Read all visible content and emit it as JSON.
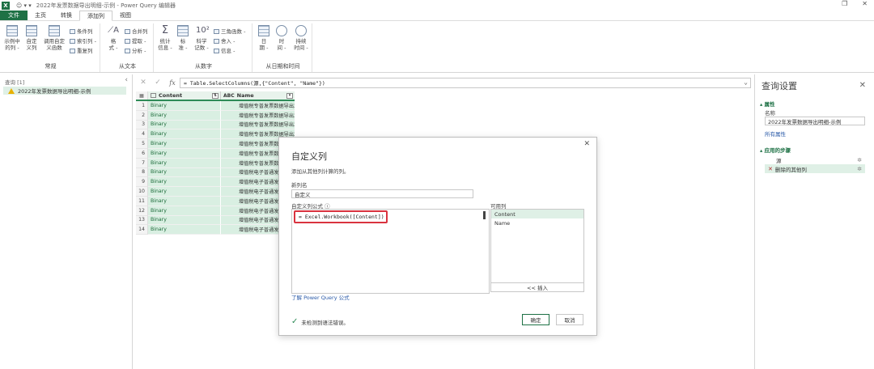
{
  "window": {
    "app_badge": "X",
    "title": "2022年发票数据导出明细-示例 - Power Query 编辑器",
    "qat": "☺ ▾ ▾"
  },
  "tabs": [
    {
      "label": "文件"
    },
    {
      "label": "主页"
    },
    {
      "label": "转换"
    },
    {
      "label": "添加列"
    },
    {
      "label": "视图"
    }
  ],
  "ribbon": {
    "general": {
      "label": "常规",
      "example_col": "示例中\n的列 -",
      "custom_col": "自定\n义列",
      "invoke_func": "调用自定\n义函数",
      "cond_col": "条件列",
      "index_col": "索引列 -",
      "dup_col": "重复列"
    },
    "from_text": {
      "label": "从文本",
      "format": "格\n式 -",
      "merge": "合并列",
      "extract": "提取 -",
      "parse": "分析 -"
    },
    "from_number": {
      "label": "从数字",
      "stats": "统计\n信息 -",
      "standard": "标\n准 -",
      "scientific": "科学\n记数 -",
      "trig": "三角函数 -",
      "round": "舍入 -",
      "info": "信息 -"
    },
    "from_datetime": {
      "label": "从日期和时间",
      "date": "日\n期 -",
      "time": "时\n间 -",
      "duration": "持续\n时间 -"
    }
  },
  "queries_pane": {
    "header": "查询 [1]",
    "item": "2022年发票数据导出明细-示例"
  },
  "formula_bar": {
    "cancel": "✕",
    "commit": "✓",
    "fx": "fx",
    "formula": "= Table.SelectColumns(源,{\"Content\", \"Name\"})"
  },
  "grid": {
    "col_content": "Content",
    "col_name": "Name",
    "rows": [
      {
        "n": "1",
        "content": "Binary",
        "name": "增值税专普发票数据导出20..."
      },
      {
        "n": "2",
        "content": "Binary",
        "name": "增值税专普发票数据导出20..."
      },
      {
        "n": "3",
        "content": "Binary",
        "name": "增值税专普发票数据导出20..."
      },
      {
        "n": "4",
        "content": "Binary",
        "name": "增值税专普发票数据导出20..."
      },
      {
        "n": "5",
        "content": "Binary",
        "name": "增值税专普发票数据导出20..."
      },
      {
        "n": "6",
        "content": "Binary",
        "name": "增值税专普发票数据导出20..."
      },
      {
        "n": "7",
        "content": "Binary",
        "name": "增值税专普发票数据导出20..."
      },
      {
        "n": "8",
        "content": "Binary",
        "name": "增值税电子普通发票数据..."
      },
      {
        "n": "9",
        "content": "Binary",
        "name": "增值税电子普通发票数据..."
      },
      {
        "n": "10",
        "content": "Binary",
        "name": "增值税电子普通发票数据..."
      },
      {
        "n": "11",
        "content": "Binary",
        "name": "增值税电子普通发票数据..."
      },
      {
        "n": "12",
        "content": "Binary",
        "name": "增值税电子普通发票数据..."
      },
      {
        "n": "13",
        "content": "Binary",
        "name": "增值税电子普通发票数据..."
      },
      {
        "n": "14",
        "content": "Binary",
        "name": "增值税电子普通发票数据..."
      }
    ]
  },
  "settings_pane": {
    "title": "查询设置",
    "props_section": "▴ 属性",
    "name_label": "名称",
    "name_value": "2022年发票数据导出明细-示例",
    "all_props": "所有属性",
    "steps_section": "▴ 应用的步骤",
    "steps": [
      {
        "label": "源"
      },
      {
        "label": "删除的其他列"
      }
    ]
  },
  "dialog": {
    "title": "自定义列",
    "subtitle": "添加从其他列计算的列。",
    "new_col_label": "新列名",
    "new_col_value": "自定义",
    "formula_label": "自定义列公式 ⓘ",
    "formula_value": "= Excel.Workbook([Content])",
    "available_label": "可用列",
    "columns": [
      "Content",
      "Name"
    ],
    "insert_btn": "<< 插入",
    "learn_link": "了解 Power Query 公式",
    "status": "未检测到语法错误。",
    "ok": "确定",
    "cancel": "取消"
  }
}
